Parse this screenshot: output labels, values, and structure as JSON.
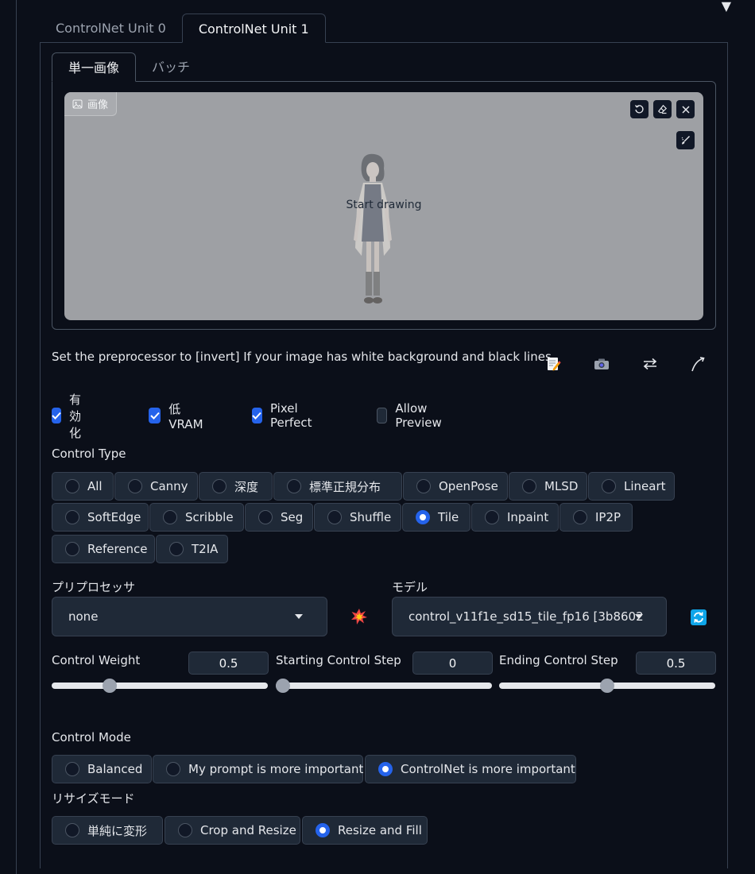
{
  "units": {
    "tabs": [
      {
        "label": "ControlNet Unit 0"
      },
      {
        "label": "ControlNet Unit 1"
      }
    ],
    "active": 1
  },
  "image_tabs": [
    {
      "label": "単一画像"
    },
    {
      "label": "バッチ"
    }
  ],
  "canvas": {
    "label": "画像",
    "placeholder": "Start drawing"
  },
  "hint": "Set the preprocessor to [invert] If your image has white background and black lines.",
  "checkboxes": [
    {
      "label": "有効化",
      "checked": true
    },
    {
      "label": "低 VRAM",
      "checked": true
    },
    {
      "label": "Pixel Perfect",
      "checked": true
    },
    {
      "label": "Allow Preview",
      "checked": false
    }
  ],
  "control_type": {
    "label": "Control Type",
    "options": [
      "All",
      "Canny",
      "深度",
      "標準正規分布",
      "OpenPose",
      "MLSD",
      "Lineart",
      "SoftEdge",
      "Scribble",
      "Seg",
      "Shuffle",
      "Tile",
      "Inpaint",
      "IP2P",
      "Reference",
      "T2IA"
    ],
    "selected": "Tile"
  },
  "preprocessor": {
    "label": "プリプロセッサ",
    "value": "none"
  },
  "model": {
    "label": "モデル",
    "value": "control_v11f1e_sd15_tile_fp16 [3b8602"
  },
  "sliders": [
    {
      "label": "Control Weight",
      "value": "0.5",
      "fraction": 0.25
    },
    {
      "label": "Starting Control Step",
      "value": "0",
      "fraction": 0.0
    },
    {
      "label": "Ending Control Step",
      "value": "0.5",
      "fraction": 0.5
    }
  ],
  "control_mode": {
    "label": "Control Mode",
    "options": [
      "Balanced",
      "My prompt is more important",
      "ControlNet is more important"
    ],
    "selected": "ControlNet is more important"
  },
  "resize_mode": {
    "label": "リサイズモード",
    "options": [
      "単純に変形",
      "Crop and Resize",
      "Resize and Fill"
    ],
    "selected": "Resize and Fill"
  },
  "colors": {
    "accent": "#2563eb",
    "background": "#0b0f19",
    "panel": "#1f2937",
    "border": "#374151"
  }
}
